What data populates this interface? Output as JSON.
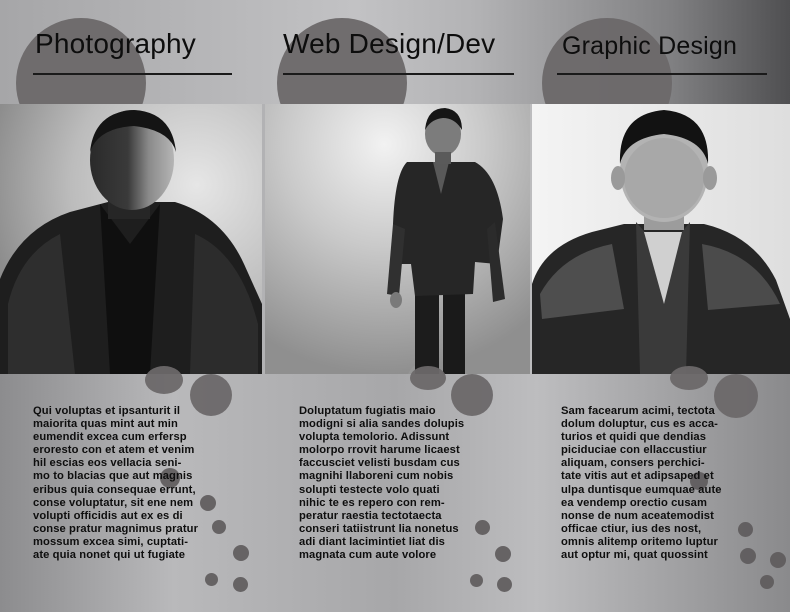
{
  "panels": [
    {
      "heading": "Photography",
      "paragraph_lines": [
        "Qui voluptas et ipsanturit il",
        "maiorita quas mint aut min",
        "eumendit excea cum erfersp",
        "eroresto con et atem et venim",
        "hil escias eos vellacia seni-",
        "mo to blacias que aut magnis",
        "eribus quia consequae errunt,",
        "conse voluptatur, sit ene nem",
        "volupti officidis aut ex es di",
        "conse pratur magnimus pratur",
        "mossum excea simi, cuptati-",
        "ate quia nonet qui ut fugiate"
      ],
      "photo": "portrait-headshot-side-lit"
    },
    {
      "heading": "Web Design/Dev",
      "paragraph_lines": [
        "Doluptatum fugiatis maio",
        "modigni si alia sandes dolupis",
        "volupta temolorio. Adissunt",
        "molorpo rrovit harume licaest",
        "faccusciet velisti busdam cus",
        "magnihi llaboreni cum nobis",
        "solupti testecte volo quati",
        "nihic te es repero con rem-",
        "peratur raestia tectotaecta",
        "conseri tatiistrunt lia nonetus",
        "adi diant lacimintiet liat dis",
        "magnata cum aute volore"
      ],
      "photo": "portrait-full-body-standing"
    },
    {
      "heading": "Graphic Design",
      "paragraph_lines": [
        "Sam facearum acimi, tectota",
        "dolum doluptur, cus es acca-",
        "turios et quidi que dendias",
        "piciduciae con ellaccustiur",
        "aliquam, consers perchici-",
        "tate vitis aut et adipsaped et",
        "ulpa duntisque eumquae aute",
        "ea vendemp orectio cusam",
        "nonse de num aceatemodist",
        "officae ctiur, ius des nost,",
        "omnis alitemp oritemo luptur",
        "aut optur mi, quat quossint"
      ],
      "photo": "portrait-headshot-eyes-down"
    }
  ],
  "colors": {
    "circle": "#6c6869",
    "text": "#0e0e0e",
    "rule": "#1a1a1a"
  }
}
